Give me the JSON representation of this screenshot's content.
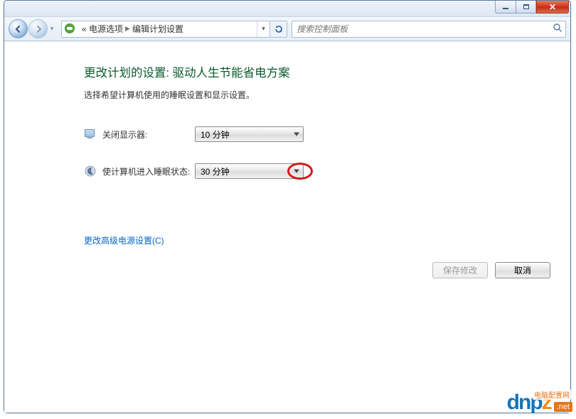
{
  "breadcrumb": {
    "prefix": "«",
    "item1": "电源选项",
    "item2": "编辑计划设置"
  },
  "search": {
    "placeholder": "搜索控制面板"
  },
  "page": {
    "title": "更改计划的设置: 驱动人生节能省电方案",
    "desc": "选择希望计算机使用的睡眠设置和显示设置。"
  },
  "rows": {
    "display_off_label": "关闭显示器:",
    "display_off_value": "10 分钟",
    "sleep_label": "使计算机进入睡眠状态:",
    "sleep_value": "30 分钟"
  },
  "link_advanced": "更改高级电源设置(C)",
  "buttons": {
    "save": "保存修改",
    "cancel": "取消"
  },
  "watermark": {
    "brand_left": "dn",
    "brand_mid": "p",
    "brand_right": "z",
    "tld": ".net",
    "cn": "电脑配置网"
  }
}
